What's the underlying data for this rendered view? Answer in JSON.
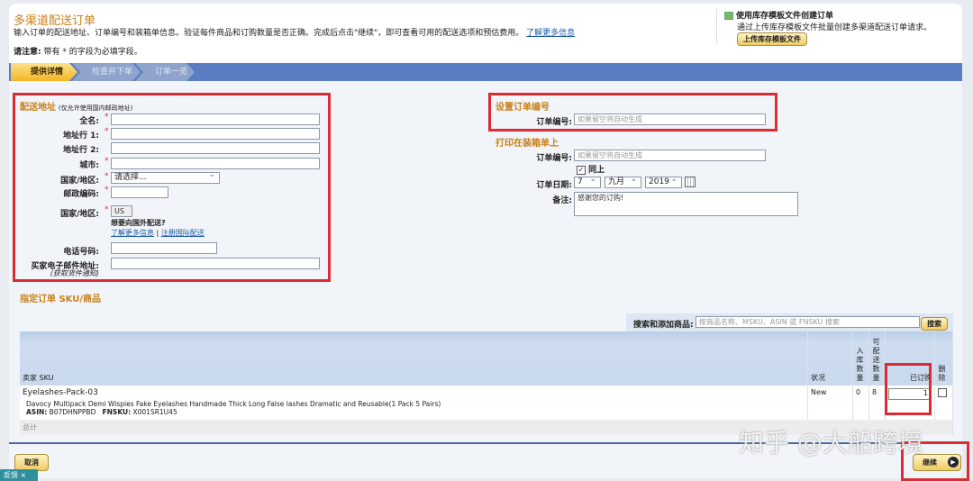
{
  "header": {
    "title": "多渠道配送订单",
    "description": "输入订单的配送地址、订单编号和装箱单信息。验证每件商品和订购数量是否正确。完成后点击\"继续\"，即可查看可用的配送选项和预估费用。",
    "learn_more": "了解更多信息",
    "note_label": "请注意:",
    "note_text": " 带有 * 的字段为必填字段。"
  },
  "template": {
    "title": "使用库存模板文件创建订单",
    "desc": "通过上传库存模板文件批量创建多渠道配送订单请求。",
    "button": "上传库存模板文件"
  },
  "steps": [
    "提供详情",
    "检查并下单",
    "订单一览"
  ],
  "shipping": {
    "title": "配送地址",
    "hint": "(仅允许使用国内邮政地址)",
    "full_name": "全名:",
    "addr1": "地址行 1:",
    "addr2": "地址行 2:",
    "city": "城市:",
    "country": "国家/地区:",
    "country_value": "请选择...",
    "postal": "邮政编码:",
    "country2": "国家/地区:",
    "country2_value": "US",
    "intl_q": "想要向国外配送?",
    "intl_learn": "了解更多信息",
    "sep": "|",
    "intl_register": "注册国际配送",
    "phone": "电话号码:",
    "email": "买家电子邮件地址:",
    "email_hint": "(获取货件通知)"
  },
  "order_id": {
    "title": "设置订单编号",
    "label": "订单编号:",
    "placeholder": "如果留空将自动生成"
  },
  "packing": {
    "title": "打印在装箱单上",
    "label": "订单编号:",
    "placeholder": "如果留空将自动生成",
    "same": "同上",
    "date_label": "订单日期:",
    "day": "7",
    "month": "九月",
    "year": "2019",
    "note_label": "备注:",
    "note_value": "感谢您的订购!"
  },
  "items": {
    "title": "指定订单 SKU/商品",
    "search_label": "搜索和添加商品:",
    "search_placeholder": "按商品名称、MSKU、ASIN 或 FNSKU 搜索",
    "search_button": "搜索",
    "columns": {
      "sku": "卖家 SKU",
      "condition": "状况",
      "inbound": "入库数量",
      "available": "可配送数量",
      "ordered": "已订购",
      "delete": "删除"
    },
    "rows": [
      {
        "sku": "Eyelashes-Pack-03",
        "title": "Davocy Multipack Demi Wispies Fake Eyelashes Handmade Thick Long False lashes Dramatic and Reusable(1 Pack 5 Pairs)",
        "asin_label": "ASIN:",
        "asin": "B07DHNPPBD",
        "fnsku_label": "FNSKU:",
        "fnsku": "X001SR1U45",
        "condition": "New",
        "inbound": "0",
        "available": "8",
        "ordered": "1"
      }
    ],
    "total": "总计"
  },
  "footer": {
    "cancel": "取消",
    "continue": "继续",
    "feedback": "反馈"
  },
  "watermark": "知乎 @大船跨境"
}
